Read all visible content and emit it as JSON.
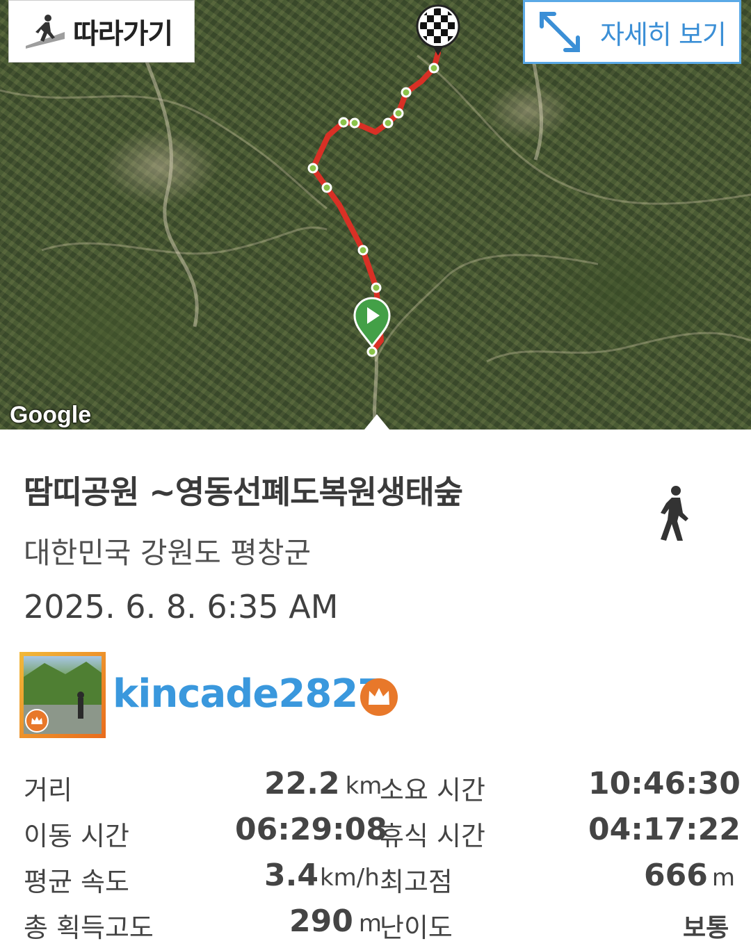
{
  "map": {
    "follow_button": {
      "label": "따라가기",
      "icon": "hiker-walking-icon"
    },
    "detail_button": {
      "label": "자세히 보기",
      "icon": "expand-arrows-icon"
    },
    "attribution": "Google",
    "route_color": "#d93025",
    "start_marker_color": "#43a047"
  },
  "track": {
    "title": "땀띠공원 ~영동선폐도복원생태숲",
    "activity_icon": "walking-person-icon",
    "location": "대한민국 강원도 평창군",
    "datetime": "2025. 6. 8. 6:35 AM"
  },
  "user": {
    "username": "kincade2827",
    "badge_icon": "crown-badge-icon"
  },
  "stats": {
    "distance": {
      "label": "거리",
      "value": "22.2",
      "unit": "km"
    },
    "total_time": {
      "label": "소요 시간",
      "value": "10:46:30"
    },
    "moving_time": {
      "label": "이동 시간",
      "value": "06:29:08"
    },
    "rest_time": {
      "label": "휴식 시간",
      "value": "04:17:22"
    },
    "avg_speed": {
      "label": "평균 속도",
      "value": "3.4",
      "unit": "km/h"
    },
    "max_altitude": {
      "label": "최고점",
      "value": "666",
      "unit": "m"
    },
    "total_ascent": {
      "label": "총 획득고도",
      "value": "290",
      "unit": "m"
    },
    "difficulty": {
      "label": "난이도",
      "value": "보통"
    }
  }
}
